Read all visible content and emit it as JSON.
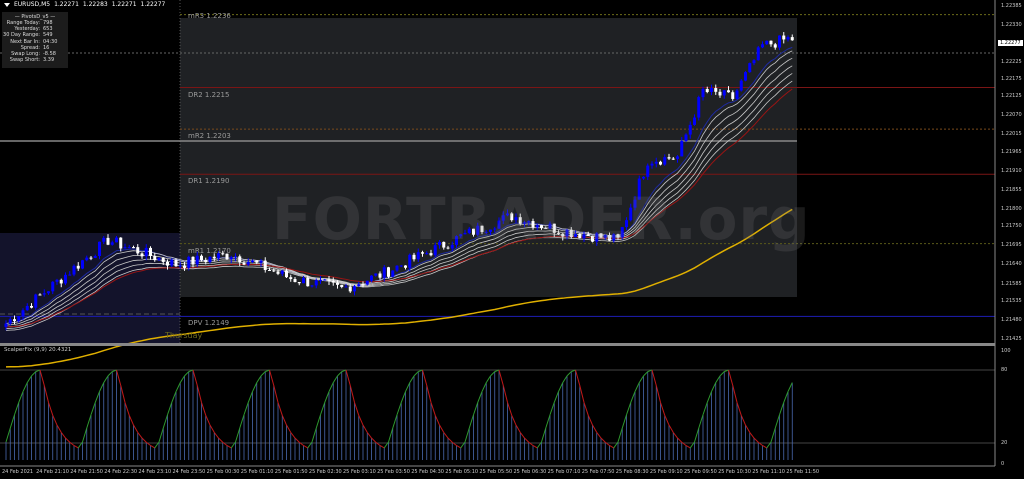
{
  "header": {
    "symbol": "EURUSD,M5",
    "open": "1.22271",
    "high": "1.22283",
    "low": "1.22271",
    "close": "1.22277"
  },
  "info_panel": {
    "title": "PivotsD_v5",
    "rows": [
      {
        "label": "Range  Today:",
        "value": "798"
      },
      {
        "label": "Yesterday:",
        "value": "653"
      },
      {
        "label": "30 Day Range:",
        "value": "549"
      },
      {
        "label": "Next Bar In:",
        "value": "04:30"
      },
      {
        "label": "Spread:",
        "value": "16"
      },
      {
        "label": "Swap  Long:",
        "value": "-8.58"
      },
      {
        "label": "Swap  Short:",
        "value": "3.39"
      }
    ]
  },
  "pivots": [
    {
      "name": "mR3",
      "value": "1.2236",
      "price": 1.2236,
      "color": "#6b6b1a",
      "style": "dotted"
    },
    {
      "name": "DR2",
      "value": "1.2215",
      "price": 1.2215,
      "color": "#7a1515",
      "style": "solid"
    },
    {
      "name": "mR2",
      "value": "1.2203",
      "price": 1.2203,
      "color": "#7a4a1a",
      "style": "dotted"
    },
    {
      "name": "DR1",
      "value": "1.2190",
      "price": 1.219,
      "color": "#7a1515",
      "style": "solid"
    },
    {
      "name": "mR1",
      "value": "1.2170",
      "price": 1.217,
      "color": "#5a5a1a",
      "style": "dotted"
    },
    {
      "name": "DPV",
      "value": "1.2149",
      "price": 1.2149,
      "color": "#1a1aa0",
      "style": "solid"
    }
  ],
  "watermark": "FORTRADER.org",
  "day_label": "Thursday",
  "price_axis": [
    "1.22385",
    "1.22330",
    "1.22225",
    "1.22175",
    "1.22125",
    "1.22070",
    "1.22015",
    "1.21965",
    "1.21910",
    "1.21855",
    "1.21800",
    "1.21750",
    "1.21695",
    "1.21640",
    "1.21585",
    "1.21535",
    "1.21480",
    "1.21425"
  ],
  "current_price": "1.22277",
  "indicator": {
    "label": "ScalperFix (9,9) 20.4321",
    "levels": [
      "100",
      "80",
      "20",
      "0"
    ]
  },
  "time_axis": [
    "24 Feb 2021",
    "24 Feb 21:10",
    "24 Feb 21:50",
    "24 Feb 22:30",
    "24 Feb 23:10",
    "24 Feb 23:50",
    "25 Feb 00:30",
    "25 Feb 01:10",
    "25 Feb 01:50",
    "25 Feb 02:30",
    "25 Feb 03:10",
    "25 Feb 03:50",
    "25 Feb 04:30",
    "25 Feb 05:10",
    "25 Feb 05:50",
    "25 Feb 06:30",
    "25 Feb 07:10",
    "25 Feb 07:50",
    "25 Feb 08:30",
    "25 Feb 09:10",
    "25 Feb 09:50",
    "25 Feb 10:30",
    "25 Feb 11:10",
    "25 Feb 11:50"
  ],
  "chart_data": {
    "type": "candlestick",
    "price_range": [
      1.21425,
      1.22385
    ],
    "close_keypoints": [
      [
        0,
        1.2147
      ],
      [
        24,
        1.2171
      ],
      [
        40,
        1.2164
      ],
      [
        53,
        1.2167
      ],
      [
        67,
        1.216
      ],
      [
        79,
        1.2157
      ],
      [
        88,
        1.2161
      ],
      [
        107,
        1.2172
      ],
      [
        119,
        1.2178
      ],
      [
        130,
        1.2174
      ],
      [
        144,
        1.2171
      ],
      [
        151,
        1.2194
      ],
      [
        158,
        1.2195
      ],
      [
        164,
        1.2214
      ],
      [
        171,
        1.2212
      ],
      [
        178,
        1.2227
      ],
      [
        184,
        1.2229
      ]
    ],
    "colors": {
      "bull": "#0000ff",
      "bear": "#ffffff",
      "ma_fast": "#1e2aa0",
      "ma_bands": "#c8c8c8",
      "ma_slow": "#9a1414",
      "ma_long": "#e0b000"
    }
  }
}
